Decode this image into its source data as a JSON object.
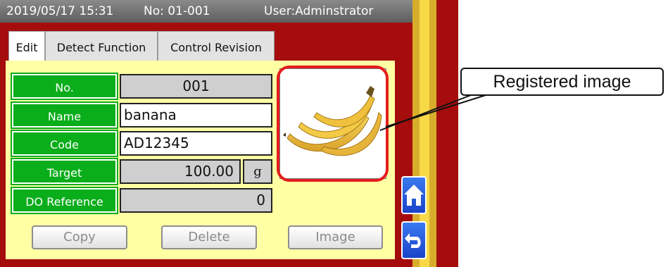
{
  "title_bar": {
    "datetime": "2019/05/17 15:31",
    "record_no": "No: 01-001",
    "user": "User:Adminstrator"
  },
  "tabs": [
    {
      "label": "Edit",
      "active": true
    },
    {
      "label": "Detect Function",
      "active": false
    },
    {
      "label": "Control Revision",
      "active": false
    }
  ],
  "form": {
    "no": {
      "label": "No.",
      "value": "001"
    },
    "name": {
      "label": "Name",
      "value": "banana"
    },
    "code": {
      "label": "Code",
      "value": "AD12345"
    },
    "target": {
      "label": "Target",
      "value": "100.00",
      "unit": "g"
    },
    "do_reference": {
      "label": "DO Reference",
      "value": "0"
    }
  },
  "buttons": {
    "copy": "Copy",
    "delete": "Delete",
    "image": "Image"
  },
  "nav": {
    "home_icon": "home-icon",
    "back_icon": "return-arrow-icon"
  },
  "callout": {
    "text": "Registered image"
  },
  "colors": {
    "background": "#a50d0d",
    "panel": "#ffffa4",
    "label_green": "#0aad1a",
    "highlight_red": "#e41d1d",
    "nav_blue": "#1f52d8"
  }
}
